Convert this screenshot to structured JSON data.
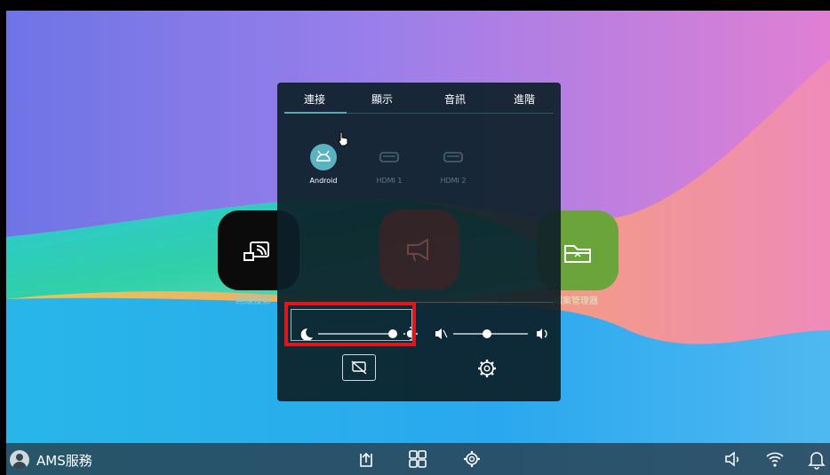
{
  "taskbar": {
    "user_label": "AMS服務",
    "icons": [
      "share-screen-icon",
      "apps-grid-icon",
      "settings-icon",
      "volume-icon",
      "wifi-icon",
      "bell-icon"
    ]
  },
  "panel": {
    "tabs": [
      {
        "label": "連接",
        "active": true
      },
      {
        "label": "顯示",
        "active": false
      },
      {
        "label": "音訊",
        "active": false
      },
      {
        "label": "進階",
        "active": false
      }
    ],
    "sources": [
      {
        "label": "Android",
        "active": true,
        "icon": "android-icon"
      },
      {
        "label": "HDMI 1",
        "active": false,
        "icon": "hdmi-icon"
      },
      {
        "label": "HDMI 2",
        "active": false,
        "icon": "hdmi-icon"
      }
    ],
    "brightness_level": 0.9,
    "volume_level": 0.35
  },
  "apps": {
    "left_label": "無線投影",
    "right_label": "檔案管理器"
  },
  "colors": {
    "accent": "#5fa7b4",
    "highlight": "#e0161c",
    "panel_bg": "#0c2028",
    "taskbar_bg": "#283a46"
  }
}
